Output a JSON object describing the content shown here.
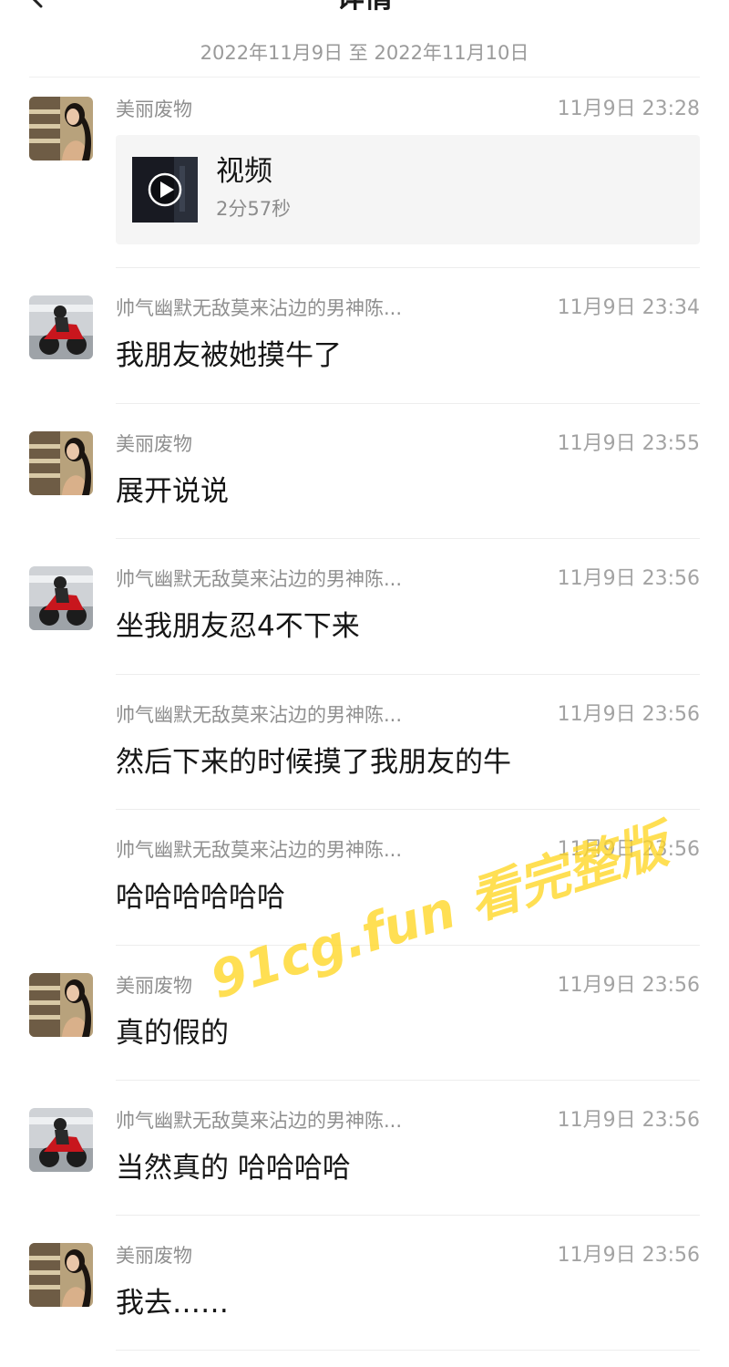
{
  "header": {
    "title": "详情",
    "date_range": "2022年11月9日 至 2022年11月10日"
  },
  "messages": [
    {
      "sender": "美丽废物",
      "time": "11月9日 23:28",
      "type": "video",
      "video_title": "视频",
      "video_duration": "2分57秒",
      "avatar": "girl-photo"
    },
    {
      "sender": "帅气幽默无敌莫来沾边的男神陈...",
      "time": "11月9日 23:34",
      "text": "我朋友被她摸牛了",
      "avatar": "motorcycle-photo"
    },
    {
      "sender": "美丽废物",
      "time": "11月9日 23:55",
      "text": "展开说说",
      "avatar": "girl-photo"
    },
    {
      "sender": "帅气幽默无敌莫来沾边的男神陈...",
      "time": "11月9日 23:56",
      "text": "坐我朋友忍4不下来",
      "avatar": "motorcycle-photo"
    },
    {
      "sender": "帅气幽默无敌莫来沾边的男神陈...",
      "time": "11月9日 23:56",
      "text": "然后下来的时候摸了我朋友的牛"
    },
    {
      "sender": "帅气幽默无敌莫来沾边的男神陈...",
      "time": "11月9日 23:56",
      "text": "哈哈哈哈哈哈"
    },
    {
      "sender": "美丽废物",
      "time": "11月9日 23:56",
      "text": "真的假的",
      "avatar": "girl-photo"
    },
    {
      "sender": "帅气幽默无敌莫来沾边的男神陈...",
      "time": "11月9日 23:56",
      "text": "当然真的 哈哈哈哈",
      "avatar": "motorcycle-photo"
    },
    {
      "sender": "美丽废物",
      "time": "11月9日 23:56",
      "text": "我去……",
      "avatar": "girl-photo"
    }
  ],
  "watermark": "91cg.fun 看完整版",
  "colors": {
    "accent_watermark": "#ffd623",
    "meta_text": "#8f8f8f",
    "card_bg": "#f5f5f5"
  }
}
